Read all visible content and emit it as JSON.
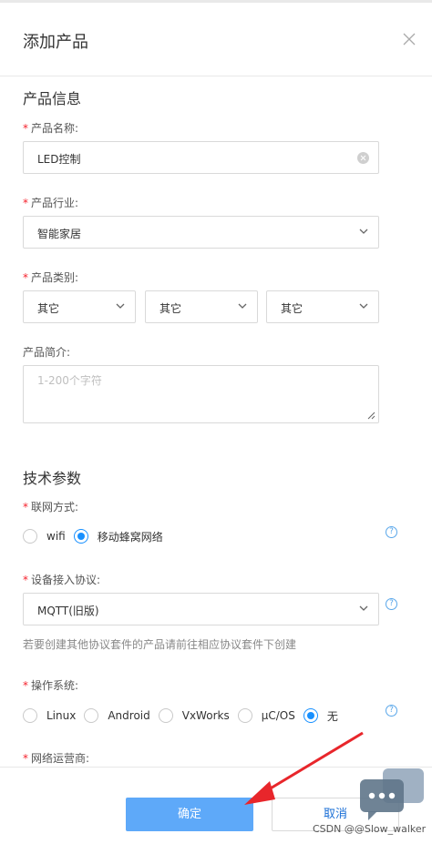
{
  "dialog": {
    "title": "添加产品",
    "close_icon": "close-icon"
  },
  "product_info": {
    "section_title": "产品信息",
    "name": {
      "label": "产品名称:",
      "value": "LED控制"
    },
    "industry": {
      "label": "产品行业:",
      "value": "智能家居"
    },
    "category": {
      "label": "产品类别:",
      "values": [
        "其它",
        "其它",
        "其它"
      ]
    },
    "intro": {
      "label": "产品简介:",
      "placeholder": "1-200个字符"
    }
  },
  "tech_params": {
    "section_title": "技术参数",
    "network": {
      "label": "联网方式:",
      "options": [
        {
          "label": "wifi",
          "selected": false
        },
        {
          "label": "移动蜂窝网络",
          "selected": true
        }
      ]
    },
    "protocol": {
      "label": "设备接入协议:",
      "value": "MQTT(旧版)",
      "hint": "若要创建其他协议套件的产品请前往相应协议套件下创建"
    },
    "os": {
      "label": "操作系统:",
      "options": [
        {
          "label": "Linux",
          "selected": false
        },
        {
          "label": "Android",
          "selected": false
        },
        {
          "label": "VxWorks",
          "selected": false
        },
        {
          "label": "μC/OS",
          "selected": false
        },
        {
          "label": "无",
          "selected": true
        }
      ]
    },
    "carrier": {
      "label": "网络运营商:"
    }
  },
  "footer": {
    "confirm_label": "确定",
    "cancel_label": "取消"
  },
  "help_symbol": "?",
  "watermark": "CSDN @@Slow_walker",
  "colors": {
    "accent": "#1890ff",
    "primary_button": "#5ea9f9",
    "required": "#f5222d",
    "annotation_arrow": "#e8262b"
  }
}
